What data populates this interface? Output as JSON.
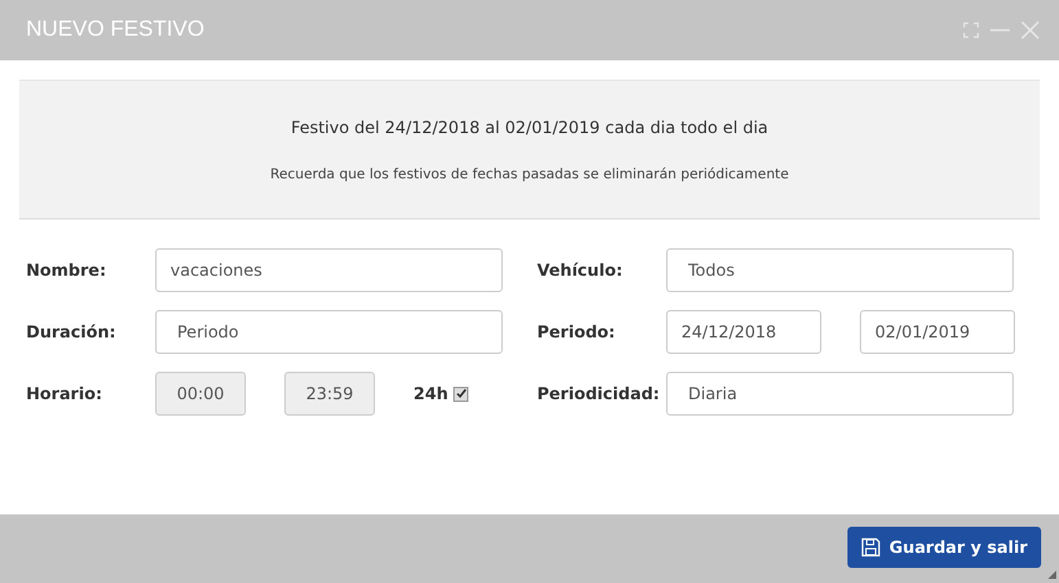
{
  "window": {
    "title": "NUEVO FESTIVO"
  },
  "summary": {
    "text": "Festivo del 24/12/2018 al 02/01/2019 cada dia todo el dia",
    "note": "Recuerda que los festivos de fechas pasadas se eliminarán periódicamente"
  },
  "left": [
    {
      "label": "Nombre:",
      "kind": "text",
      "value": "vacaciones"
    },
    {
      "label": "Duración:",
      "kind": "select",
      "value": "Periodo"
    },
    {
      "label": "Horario:",
      "kind": "times",
      "from": {
        "value": "00:00",
        "disabled": true
      },
      "to": {
        "value": "23:59",
        "disabled": true
      },
      "all_day": {
        "label": "24h",
        "checked": true
      }
    }
  ],
  "right": [
    {
      "label": "Vehículo:",
      "kind": "select",
      "value": "Todos"
    },
    {
      "label": "Periodo:",
      "kind": "dates",
      "from": "24/12/2018",
      "to": "02/01/2019"
    },
    {
      "label": "Periodicidad:",
      "kind": "select",
      "value": "Diaria"
    }
  ],
  "save_button": {
    "label": "Guardar y salir"
  }
}
